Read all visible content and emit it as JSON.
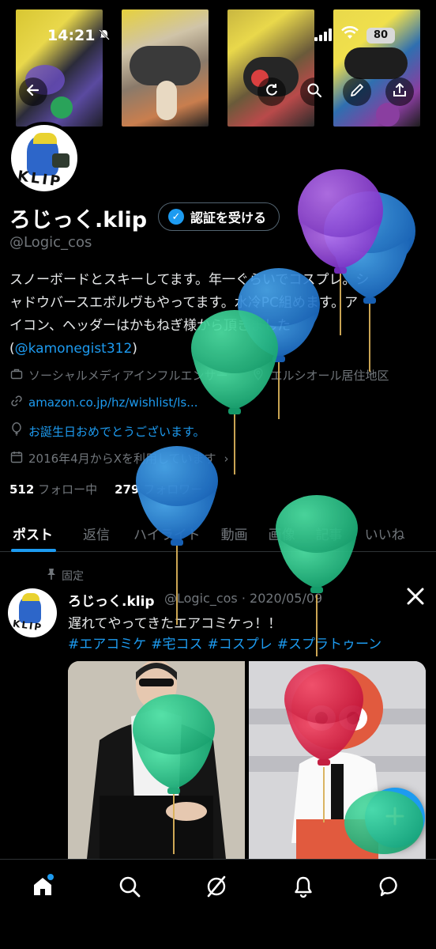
{
  "status_bar": {
    "time": "14:21",
    "battery": "80"
  },
  "profile": {
    "name": "ろじっく.klip",
    "verify_button": "認証を受ける",
    "handle": "@Logic_cos",
    "bio_line1": "スノーボードとスキーしてます。年一ぐらいでコスプレ。シ",
    "bio_line2": "ャドウバースエボルヴもやってます。水冷PC組めます。ア",
    "bio_line3": "イコン、ヘッダーはかもねぎ様から頂きました",
    "bio_open_paren": "(",
    "bio_mention": "@kamonegist312",
    "bio_close_paren": ")",
    "category": "ソーシャルメディアインフルエンサー",
    "location": "エルシオール居住地区",
    "link": "amazon.co.jp/hz/wishlist/ls...",
    "birthday": "お誕生日おめでとうございます。",
    "joined": "2016年4月からXを利用しています",
    "following_count": "512",
    "following_label": "フォロー中",
    "followers_count": "279",
    "followers_label": "フォロワー"
  },
  "tabs": [
    {
      "label": "ポスト"
    },
    {
      "label": "返信"
    },
    {
      "label": "ハイライト"
    },
    {
      "label": "動画"
    },
    {
      "label": "画像"
    },
    {
      "label": "記事"
    },
    {
      "label": "いいね"
    }
  ],
  "pinned_post": {
    "pinned_label": "固定",
    "author_name": "ろじっく.klip",
    "author_handle": "@Logic_cos",
    "date": "2020/05/09",
    "text": "遅れてやってきたエアコミケっ！！",
    "hashtags": [
      "#エアコミケ",
      "#宅コス",
      "#コスプレ",
      "#スプラトゥーン"
    ]
  },
  "avatar_text": "KLIP",
  "colors": {
    "background": "#000000",
    "accent": "#1d9bf0",
    "text_primary": "#e7e9ea",
    "text_secondary": "#71767b",
    "border": "#2f3336"
  },
  "icons": {
    "back": "back-arrow-icon",
    "refresh": "refresh-icon",
    "search": "search-icon",
    "edit": "edit-icon",
    "share": "share-icon",
    "nav": [
      "home-icon",
      "search-icon",
      "grok-icon",
      "notifications-icon",
      "messages-icon"
    ]
  }
}
